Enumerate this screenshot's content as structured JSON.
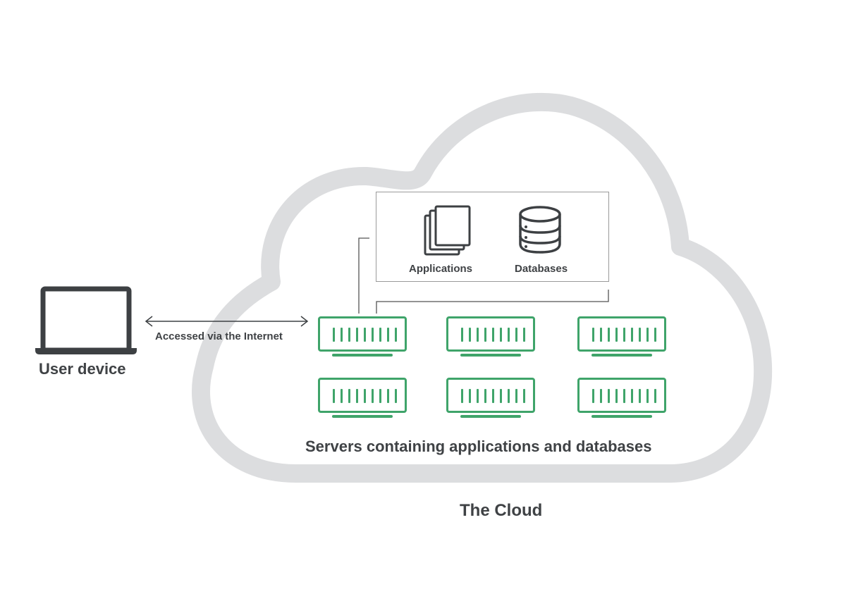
{
  "diagram": {
    "title": "The Cloud",
    "user_device": {
      "label": "User device",
      "icon": "laptop-icon"
    },
    "connection": {
      "label": "Accessed via the Internet",
      "icon": "double-arrow-icon"
    },
    "content_box": {
      "items": [
        {
          "label": "Applications",
          "icon": "stacked-documents-icon"
        },
        {
          "label": "Databases",
          "icon": "database-icon"
        }
      ]
    },
    "servers": {
      "label": "Servers containing applications and databases",
      "rows": 2,
      "columns": 3,
      "count": 6
    },
    "colors": {
      "cloud_outline": "#dcdddf",
      "server_green": "#3fa46a",
      "text_dark": "#3f4245",
      "icon_dark": "#3d4043",
      "box_border": "#9a9a9a"
    }
  }
}
